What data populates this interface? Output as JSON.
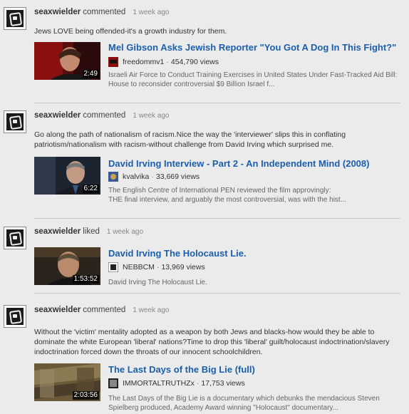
{
  "entries": [
    {
      "user": "seaxwielder",
      "action": "commented",
      "time": "1 week ago",
      "comment": "Jews LOVE being offended-it's a growth industry for them.",
      "video": {
        "title": "Mel Gibson Asks Jewish Reporter \"You Got A Dog In This Fight?\"",
        "duration": "2:49",
        "channel": "freedommv1",
        "views": "454,790 views",
        "description": "Israeli Air Force to Conduct Training Exercises in United States Under Fast-Tracked Aid Bill: House to reconsider controversial $9 Billion Israel f..."
      }
    },
    {
      "user": "seaxwielder",
      "action": "commented",
      "time": "1 week ago",
      "comment": "Go along the path of nationalism of racism.Nice the way the 'interviewer' slips this in conflating patriotism/nationalism with racism-without challenge from David Irving which surprised me.",
      "video": {
        "title": "David Irving Interview - Part 2 - An Independent Mind (2008)",
        "duration": "6:22",
        "channel": "kvalvika",
        "views": "33,669 views",
        "description": "The English Centre of International PEN reviewed the film approvingly:\nTHE final interview, and arguably the most controversial, was with the hist..."
      }
    },
    {
      "user": "seaxwielder",
      "action": "liked",
      "time": "1 week ago",
      "comment": "",
      "video": {
        "title": "David Irving The Holocaust Lie.",
        "duration": "1:53:52",
        "channel": "NEBBCM",
        "views": "13,969 views",
        "description": "David Irving The Holocaust Lie."
      }
    },
    {
      "user": "seaxwielder",
      "action": "commented",
      "time": "1 week ago",
      "comment": "Without the 'victim' mentality adopted as a weapon by both Jews and blacks-how would they be able to dominate the white European 'liberal' nations?Time to drop this 'liberal' guilt/holocaust indoctrination/slavery indoctrination forced down the throats of our innocent schoolchildren.",
      "video": {
        "title": "The Last Days of the Big Lie (full)",
        "duration": "2:03:56",
        "channel": "IMMORTALTRUTHZx",
        "views": "17,753 views",
        "description": "The Last Days of the Big Lie is a documentary which debunks the mendacious Steven Spielberg produced, Academy Award winning \"Holocaust\" documentary..."
      }
    }
  ],
  "separator": "·"
}
